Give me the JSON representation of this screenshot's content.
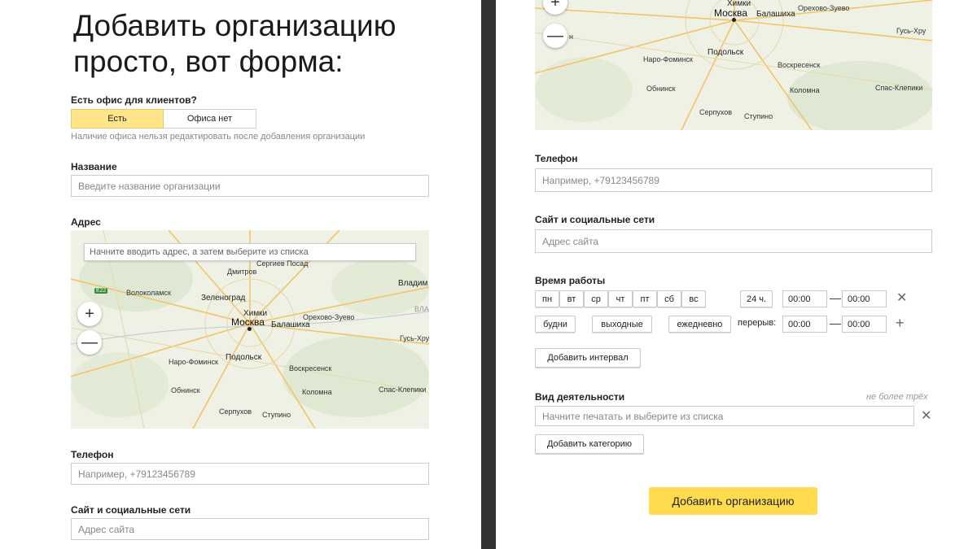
{
  "hero": {
    "title": "Добавить организацию просто, вот форма:"
  },
  "office": {
    "question": "Есть офис для клиентов?",
    "options": [
      "Есть",
      "Офиса нет"
    ],
    "selected": "Есть",
    "note": "Наличие офиса нельзя редактировать после добавления организации"
  },
  "name_field": {
    "label": "Название",
    "placeholder": "Введите название организации"
  },
  "address": {
    "label": "Адрес",
    "search_placeholder": "Начните вводить адрес, а затем выберите из списка",
    "zoom_in": "+",
    "zoom_out": "—",
    "road_badge": "E22",
    "places": {
      "dmitrov": "Дмитров",
      "sergiev_posad": "Сергиев Посад",
      "volokolamsk": "Волоколамск",
      "zelenograd": "Зеленоград",
      "vladimir": "Владим",
      "khimki": "Химки",
      "moskva": "Москва",
      "balashikha": "Балашиха",
      "orekhovo_zuevo": "Орехово-Зуево",
      "vla": "ВЛА",
      "gus_khr": "Гусь-Хру",
      "naro_fominsk": "Наро-Фоминск",
      "podolsk": "Подольск",
      "voskresensk": "Воскресенск",
      "obninsk": "Обнинск",
      "kolomna": "Коломна",
      "spas_klepiki": "Спас-Клепики",
      "serpukhov": "Серпухов",
      "stupino": "Ступино",
      "right_gus_khr": "Гусь-Хру",
      "right_n": "н"
    }
  },
  "phone": {
    "label": "Телефон",
    "placeholder": "Например, +79123456789"
  },
  "site": {
    "label": "Сайт и социальные сети",
    "placeholder": "Адрес сайта"
  },
  "hours": {
    "label": "Время работы",
    "days": [
      "пн",
      "вт",
      "ср",
      "чт",
      "пт",
      "сб",
      "вс"
    ],
    "full_day": "24 ч.",
    "from": "00:00",
    "to": "00:00",
    "presets": [
      "будни",
      "выходные",
      "ежедневно"
    ],
    "break_label": "перерыв:",
    "break_from": "00:00",
    "break_to": "00:00",
    "dash": "—",
    "add_interval": "Добавить интервал"
  },
  "activity": {
    "label": "Вид деятельности",
    "limit_note": "не более трёх",
    "placeholder": "Начните печатать и выберите из списка",
    "add_category": "Добавить категорию"
  },
  "submit": {
    "label": "Добавить организацию"
  },
  "icons": {
    "close": "close-icon",
    "add": "plus-icon"
  },
  "colors": {
    "accent": "#ffdb4d",
    "segment_active": "#ffe48a",
    "divider": "#333333"
  }
}
